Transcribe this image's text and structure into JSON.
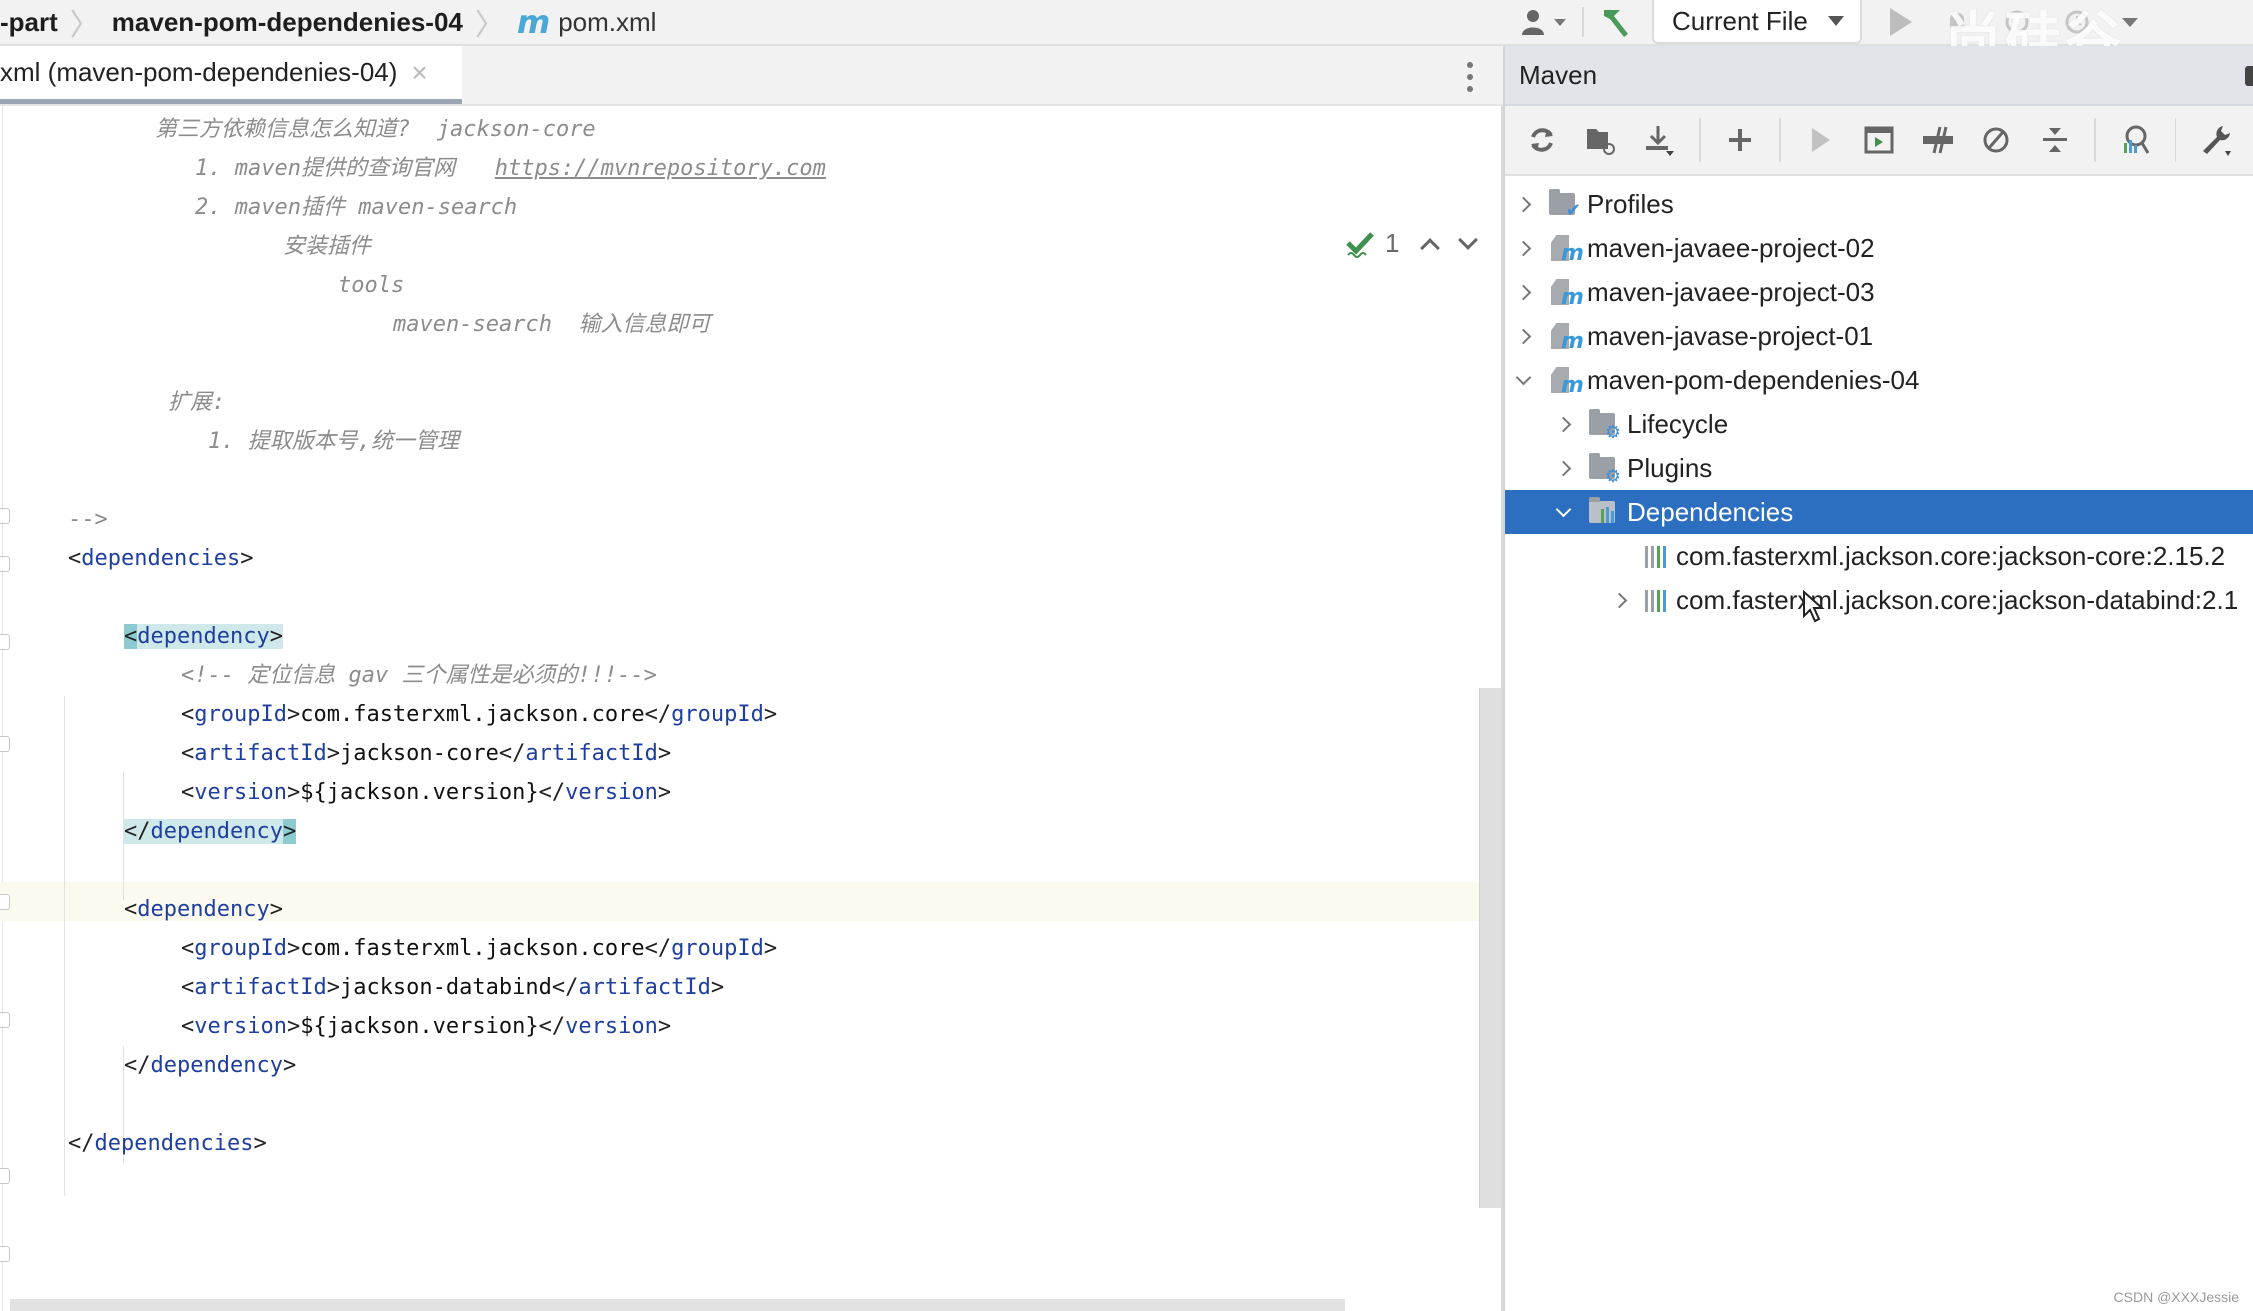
{
  "breadcrumb": {
    "items": [
      "-part",
      "maven-pom-dependenies-04",
      "pom.xml"
    ],
    "file_icon_letter": "m"
  },
  "toolbar": {
    "run_config_label": "Current File",
    "watermark": "尚硅谷"
  },
  "editor": {
    "tab_label": "xml (maven-pom-dependenies-04)",
    "tab_close": "×",
    "inspection_count": "1",
    "lines": {
      "l1_cn": "第三方依赖信息怎么知道?",
      "l1_en": "  jackson-core",
      "l2_num": "1. maven",
      "l2_cn": "提供的查询官网",
      "l2_url": "https://mvnrepository.com",
      "l3_num": "2. maven",
      "l3_cn": "插件",
      "l3_en": " maven-search",
      "l4": "安装插件",
      "l5": "tools",
      "l6_en": "maven-search",
      "l6_cn": "  输入信息即可",
      "l7": "扩展:",
      "l8_num": "1. ",
      "l8_cn": "提取版本号,统一管理",
      "l9": "-->",
      "deps_open": "dependencies",
      "dep1_open": "dependency",
      "dep1_comment": "<!-- 定位信息 gav 三个属性是必须的!!!-->",
      "groupId_tag": "groupId",
      "groupId_val": "com.fasterxml.jackson.core",
      "artifactId_tag": "artifactId",
      "artifact1_val": "jackson-core",
      "version_tag": "version",
      "version_val": "${jackson.version}",
      "dep_close": "dependency",
      "artifact2_val": "jackson-databind",
      "deps_close": "dependencies"
    }
  },
  "maven": {
    "title": "Maven",
    "toolbar_icons": [
      "reload-icon",
      "reload-folder-icon",
      "download-icon",
      "add-icon",
      "run-icon",
      "execute-goal-icon",
      "toggle-offline-icon",
      "skip-tests-icon",
      "collapse-all-icon",
      "analyze-dependencies-icon",
      "settings-wrench-icon"
    ],
    "tree": [
      {
        "label": "Profiles",
        "expanded": false
      },
      {
        "label": "maven-javaee-project-02",
        "expanded": false
      },
      {
        "label": "maven-javaee-project-03",
        "expanded": false
      },
      {
        "label": "maven-javase-project-01",
        "expanded": false
      },
      {
        "label": "maven-pom-dependenies-04",
        "expanded": true
      },
      {
        "label": "Lifecycle",
        "expanded": false
      },
      {
        "label": "Plugins",
        "expanded": false
      },
      {
        "label": "Dependencies",
        "expanded": true,
        "selected": true
      },
      {
        "label": "com.fasterxml.jackson.core:jackson-core:2.15.2"
      },
      {
        "label": "com.fasterxml.jackson.core:jackson-databind:2.1",
        "expanded": false
      }
    ]
  },
  "footer": {
    "credit": "CSDN @XXXJessie"
  },
  "colors": {
    "selection": "#2c6fc0",
    "xml_tag": "#1f3f9e",
    "comment": "#8c8c8c",
    "brace_match": "#cfe8ea"
  }
}
